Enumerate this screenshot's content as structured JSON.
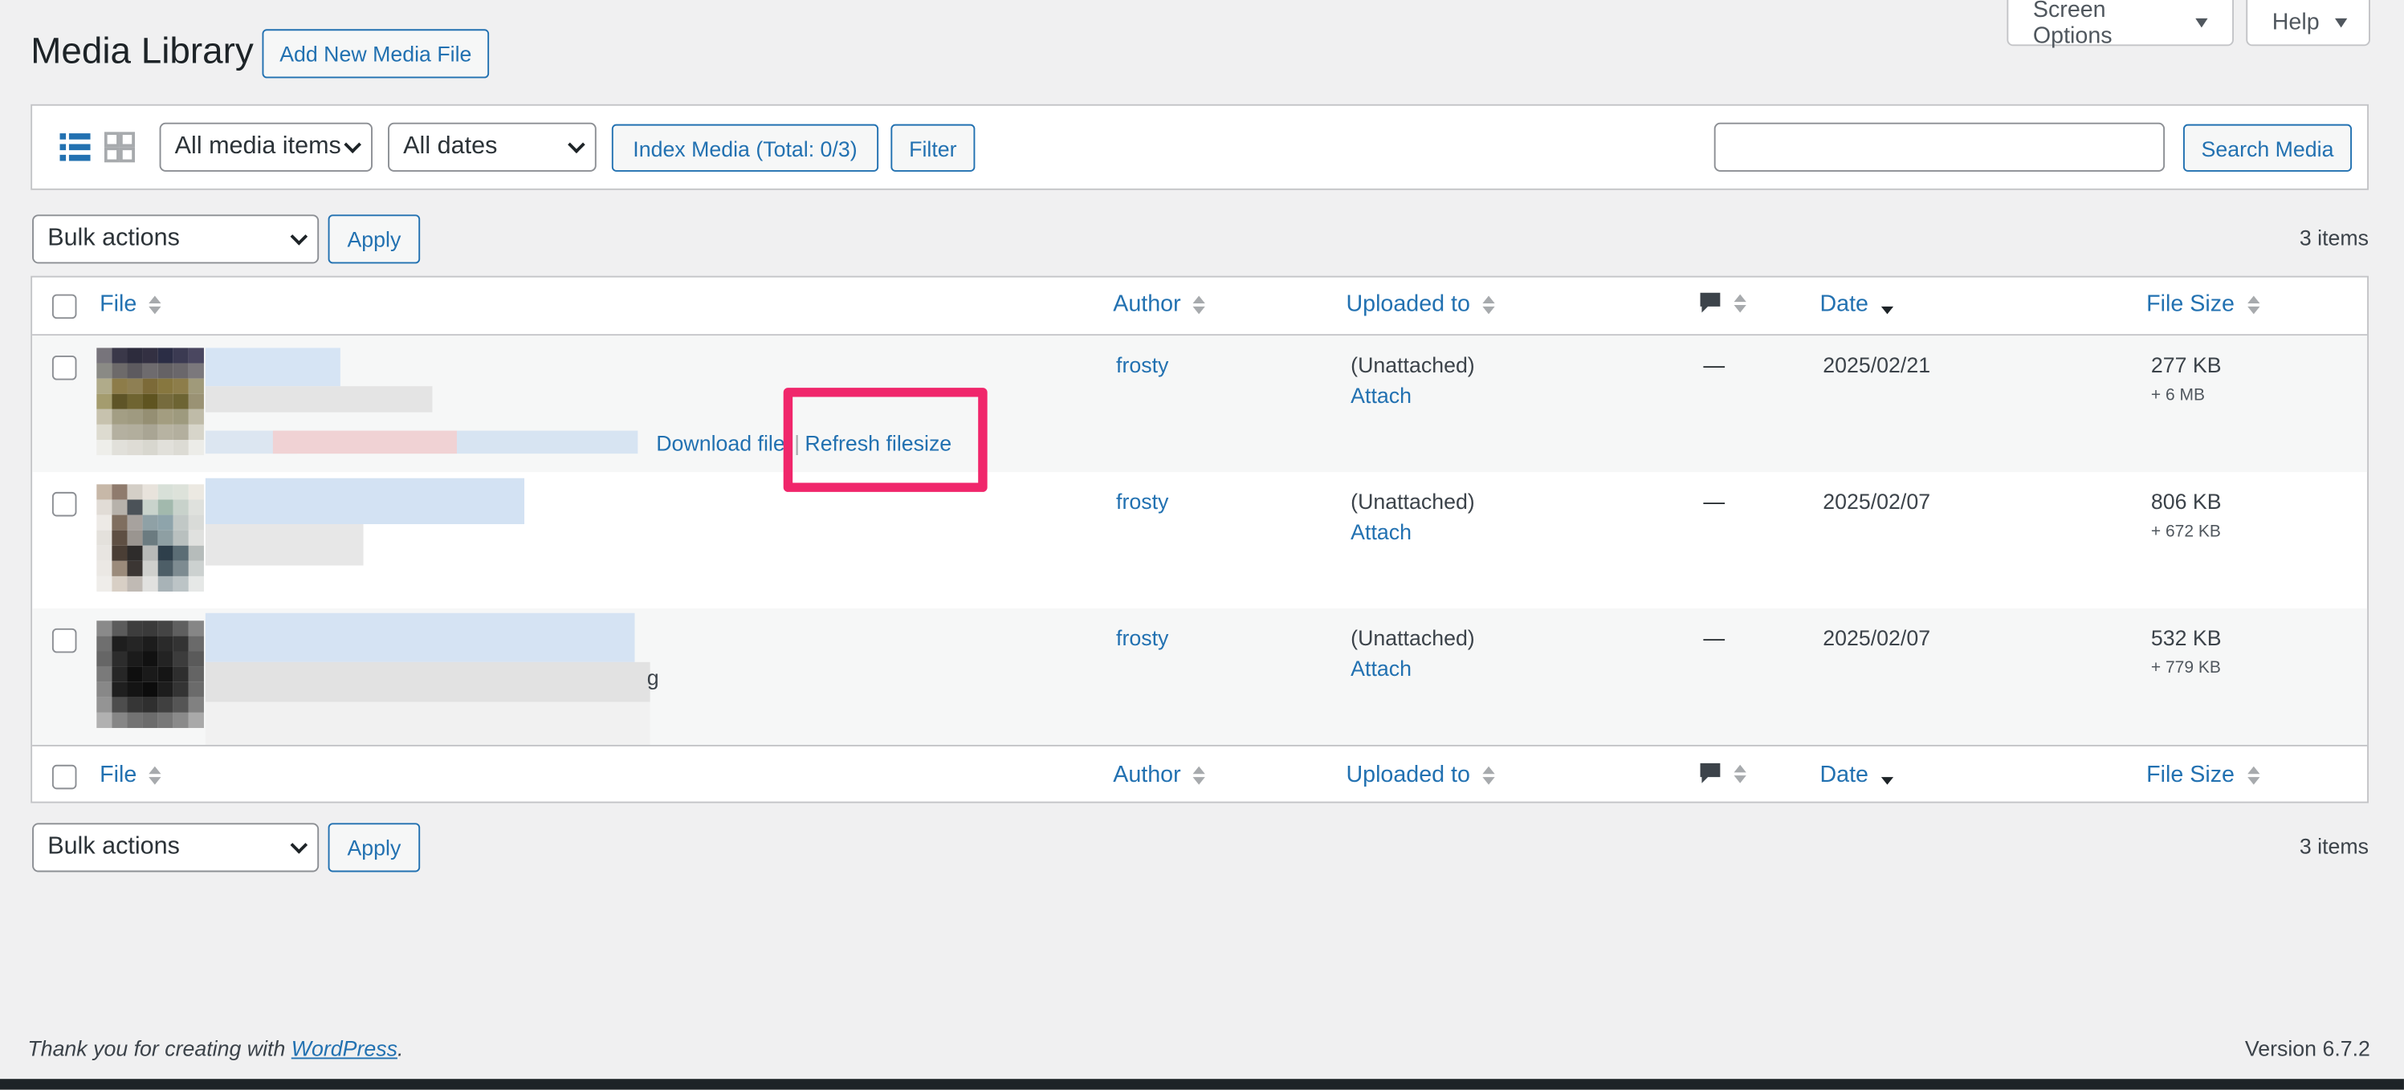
{
  "header": {
    "screen_options": "Screen Options",
    "help": "Help",
    "title": "Media Library",
    "add_new": "Add New Media File"
  },
  "filter_bar": {
    "media_type": "All media items",
    "dates": "All dates",
    "index_media": "Index Media (Total: 0/3)",
    "filter": "Filter",
    "search_value": "",
    "search_button": "Search Media"
  },
  "bulk_top": {
    "select": "Bulk actions",
    "apply": "Apply",
    "count": "3 items"
  },
  "bulk_bottom": {
    "select": "Bulk actions",
    "apply": "Apply",
    "count": "3 items"
  },
  "columns": {
    "file": "File",
    "author": "Author",
    "uploaded_to": "Uploaded to",
    "comments_icon": "comment-bubble-icon",
    "date": "Date",
    "file_size": "File Size"
  },
  "rows": [
    {
      "author": "frosty",
      "uploaded_status": "(Unattached)",
      "attach": "Attach",
      "comments": "—",
      "date": "2025/02/21",
      "size": "277 KB",
      "extra_size": "+ 6 MB",
      "actions": {
        "download": "Download file",
        "sep": "|",
        "refresh": "Refresh filesize"
      }
    },
    {
      "author": "frosty",
      "uploaded_status": "(Unattached)",
      "attach": "Attach",
      "comments": "—",
      "date": "2025/02/07",
      "size": "806 KB",
      "extra_size": "+ 672 KB"
    },
    {
      "author": "frosty",
      "uploaded_status": "(Unattached)",
      "attach": "Attach",
      "comments": "—",
      "date": "2025/02/07",
      "size": "532 KB",
      "extra_size": "+ 779 KB",
      "filename_tail": "g"
    }
  ],
  "footer": {
    "thanks_prefix": "Thank you for creating with ",
    "wp_link": "WordPress",
    "thanks_suffix": ".",
    "version": "Version 6.7.2"
  },
  "colors": {
    "accent": "#2271b1",
    "highlight": "#f0266b",
    "background": "#f0f0f1"
  }
}
